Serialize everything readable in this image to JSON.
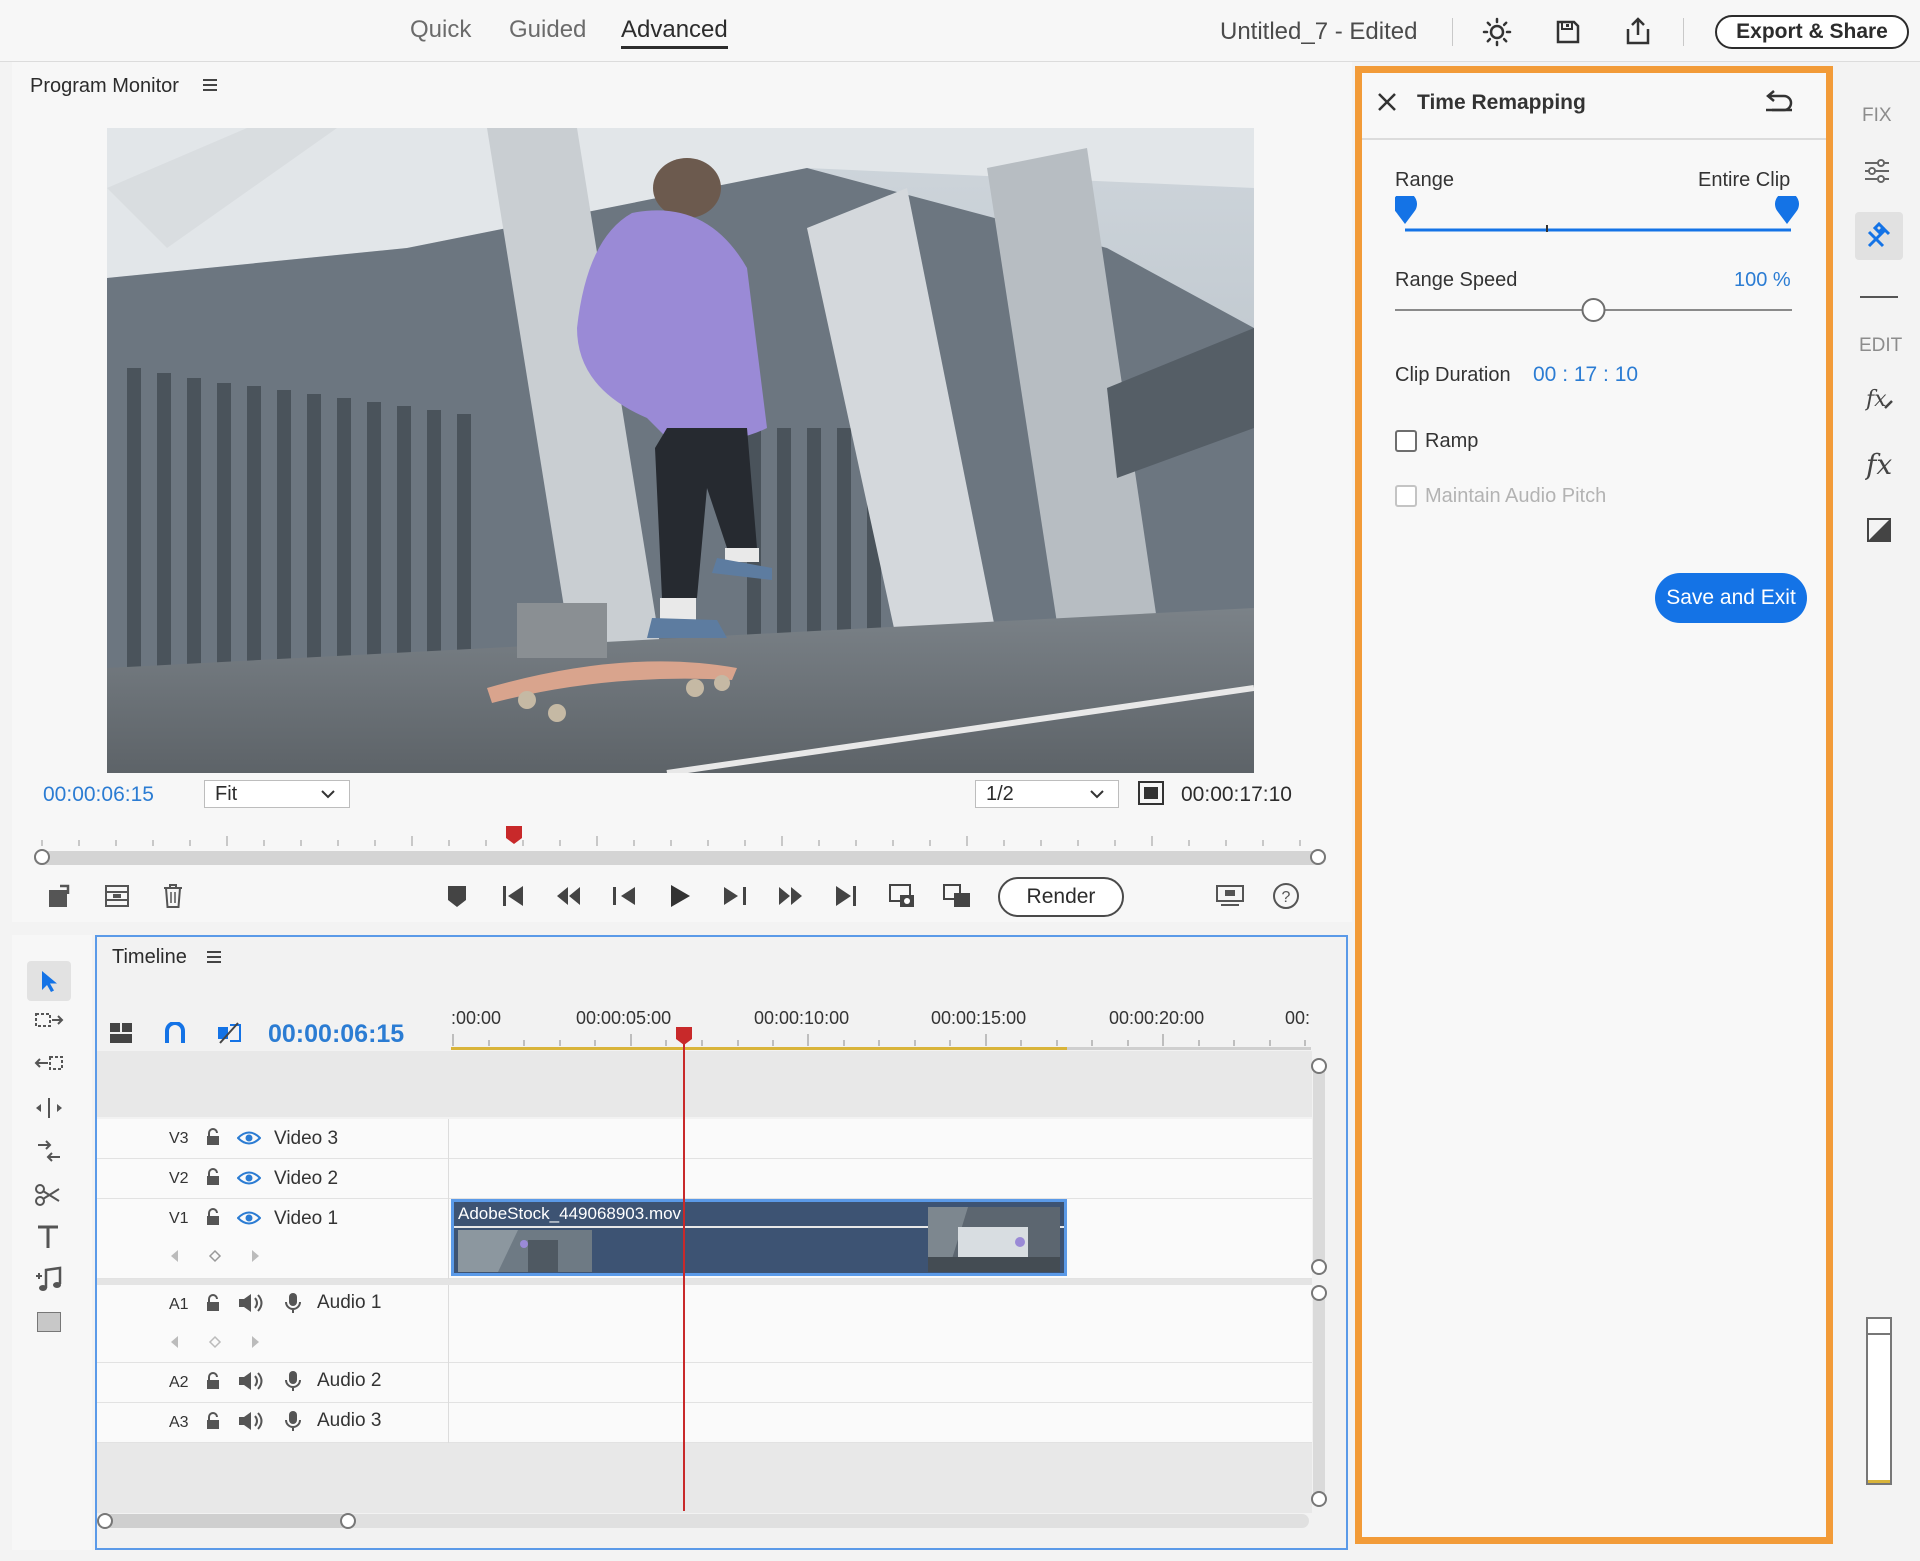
{
  "top_bar": {
    "tabs": [
      "Quick",
      "Guided",
      "Advanced"
    ],
    "active_tab": "Advanced",
    "document_title": "Untitled_7 - Edited",
    "export_label": "Export & Share"
  },
  "program_monitor": {
    "title": "Program Monitor",
    "current_timecode": "00:00:06:15",
    "fit_option": "Fit",
    "resolution_option": "1/2",
    "total_timecode": "00:00:17:10",
    "playhead_fraction": 0.37,
    "render_label": "Render"
  },
  "timeline": {
    "title": "Timeline",
    "current_timecode": "00:00:06:15",
    "ruler_ticks": [
      ":00:00",
      "00:00:05:00",
      "00:00:10:00",
      "00:00:15:00",
      "00:00:20:00",
      "00:"
    ],
    "video_tracks": [
      {
        "code": "V3",
        "name": "Video 3"
      },
      {
        "code": "V2",
        "name": "Video 2"
      },
      {
        "code": "V1",
        "name": "Video 1"
      }
    ],
    "audio_tracks": [
      {
        "code": "A1",
        "name": "Audio 1"
      },
      {
        "code": "A2",
        "name": "Audio 2"
      },
      {
        "code": "A3",
        "name": "Audio 3"
      }
    ],
    "clip_name": "AdobeStock_449068903.mov"
  },
  "time_remapping": {
    "title": "Time Remapping",
    "range_label": "Range",
    "range_value": "Entire Clip",
    "range_speed_label": "Range Speed",
    "range_speed_value": "100 %",
    "range_speed_fraction": 0.5,
    "clip_duration_label": "Clip Duration",
    "clip_duration_value": "00 : 17 : 10",
    "ramp_label": "Ramp",
    "ramp_checked": false,
    "maintain_pitch_label": "Maintain Audio Pitch",
    "maintain_pitch_checked": false,
    "save_label": "Save and Exit"
  },
  "right_rail": {
    "fix_label": "FIX",
    "edit_label": "EDIT"
  },
  "colors": {
    "accent_blue": "#1473e6",
    "timecode_blue": "#2b7cd3",
    "highlight_orange": "#f29b38",
    "playhead_red": "#c8292a",
    "clip_blue": "#3d5373"
  }
}
